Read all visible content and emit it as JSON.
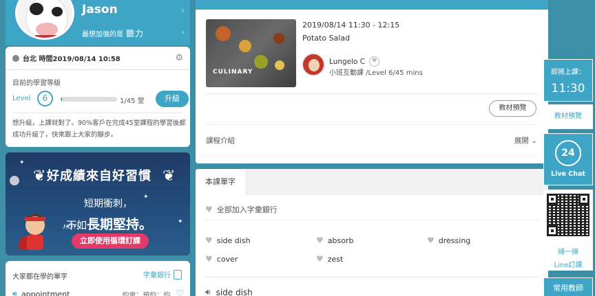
{
  "profile": {
    "name": "Jason",
    "strength_label": "最想加強的是",
    "strength_value": "聽力"
  },
  "level_card": {
    "location_time": "台北 時間2019/08/14 10:58",
    "level_heading": "目前的學習等級",
    "level_label": "Level",
    "level_number": "6",
    "progress_text": "1/45 堂",
    "progress_fraction": 0.0222,
    "upgrade_button": "升級",
    "description": "想升級，上課就對了。90%客戶在完成45堂課程的學習後都成功升級了，快來跟上大家的腳步。"
  },
  "banner": {
    "title": "好成績來自好習慣",
    "line1": "短期衝刺，",
    "line2_prefix": "不如",
    "line2_bold": "長期堅持。",
    "hot": "HOT!",
    "cta": "立即使用循環訂課"
  },
  "vocab_card": {
    "heading": "大家都在學的單字",
    "bank_link": "字彙銀行",
    "row_word": "appointment",
    "row_meta": "約會；預約；約"
  },
  "lesson": {
    "time": "2019/08/14 11:30 - 12:15",
    "title": "Potato Salad",
    "thumb_label": "CULINARY",
    "teacher_name": "Lungelo C",
    "teacher_info": "小班互動課 /Level 6/45 mins",
    "material_button": "教材預覽",
    "intro_label": "課程介紹",
    "expand_label": "展開"
  },
  "vocab_section": {
    "tab": "本課單字",
    "add_all": "全部加入字彙銀行",
    "words": [
      "side dish",
      "absorb",
      "dressing",
      "cover",
      "zest"
    ],
    "first_entry": "side dish"
  },
  "sidebar": {
    "next_class_label": "即將上課：",
    "next_class_time": "11:30",
    "textbook_preview": "教材預覽",
    "live_chat_number": "24",
    "live_chat": "Live Chat",
    "scan": "掃一掃",
    "line_order": "Line訂課",
    "common_teachers": "常用教師"
  },
  "colors": {
    "brand": "#3ea5c6",
    "background": "#3c8fa7",
    "cta": "#e43a6a"
  },
  "icons": {
    "clock": "clock-icon",
    "gear": "gear-icon",
    "heart": "heart-icon",
    "speaker": "speaker-icon",
    "chevron": "chevron-down-icon"
  }
}
